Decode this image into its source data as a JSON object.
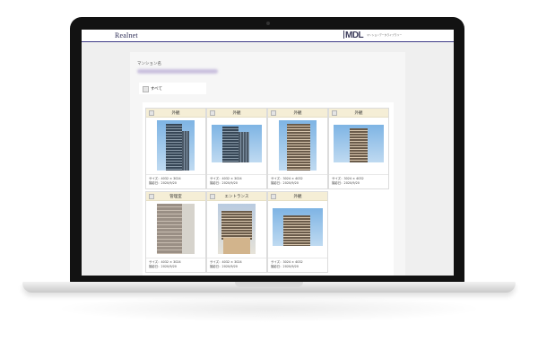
{
  "header": {
    "brand": "Realnet",
    "logo_text": "MDL",
    "logo_subtitle": "マンションデータライブラリー"
  },
  "form": {
    "field_label": "マンション名",
    "select_all_label": "すべて"
  },
  "photos": [
    {
      "title": "外観",
      "size": "サイズ：4032 × 3024",
      "date": "撮影日：2020/9/20",
      "icon": "building-photo"
    },
    {
      "title": "外観",
      "size": "サイズ：4032 × 3024",
      "date": "撮影日：2020/9/20",
      "icon": "building-photo"
    },
    {
      "title": "外観",
      "size": "サイズ：3024 × 4032",
      "date": "撮影日：2020/9/20",
      "icon": "building-photo"
    },
    {
      "title": "外観",
      "size": "サイズ：3024 × 4032",
      "date": "撮影日：2020/9/20",
      "icon": "building-photo"
    },
    {
      "title": "管理室",
      "size": "サイズ：4032 × 3024",
      "date": "撮影日：2020/9/20",
      "icon": "wall-photo"
    },
    {
      "title": "エントランス",
      "size": "サイズ：4032 × 3024",
      "date": "撮影日：2020/9/20",
      "icon": "entrance-photo"
    },
    {
      "title": "外観",
      "size": "サイズ：3024 × 4032",
      "date": "撮影日：2020/9/20",
      "icon": "building-photo"
    }
  ],
  "colors": {
    "header_accent": "#3d3b86",
    "card_header": "#f5eed6"
  }
}
